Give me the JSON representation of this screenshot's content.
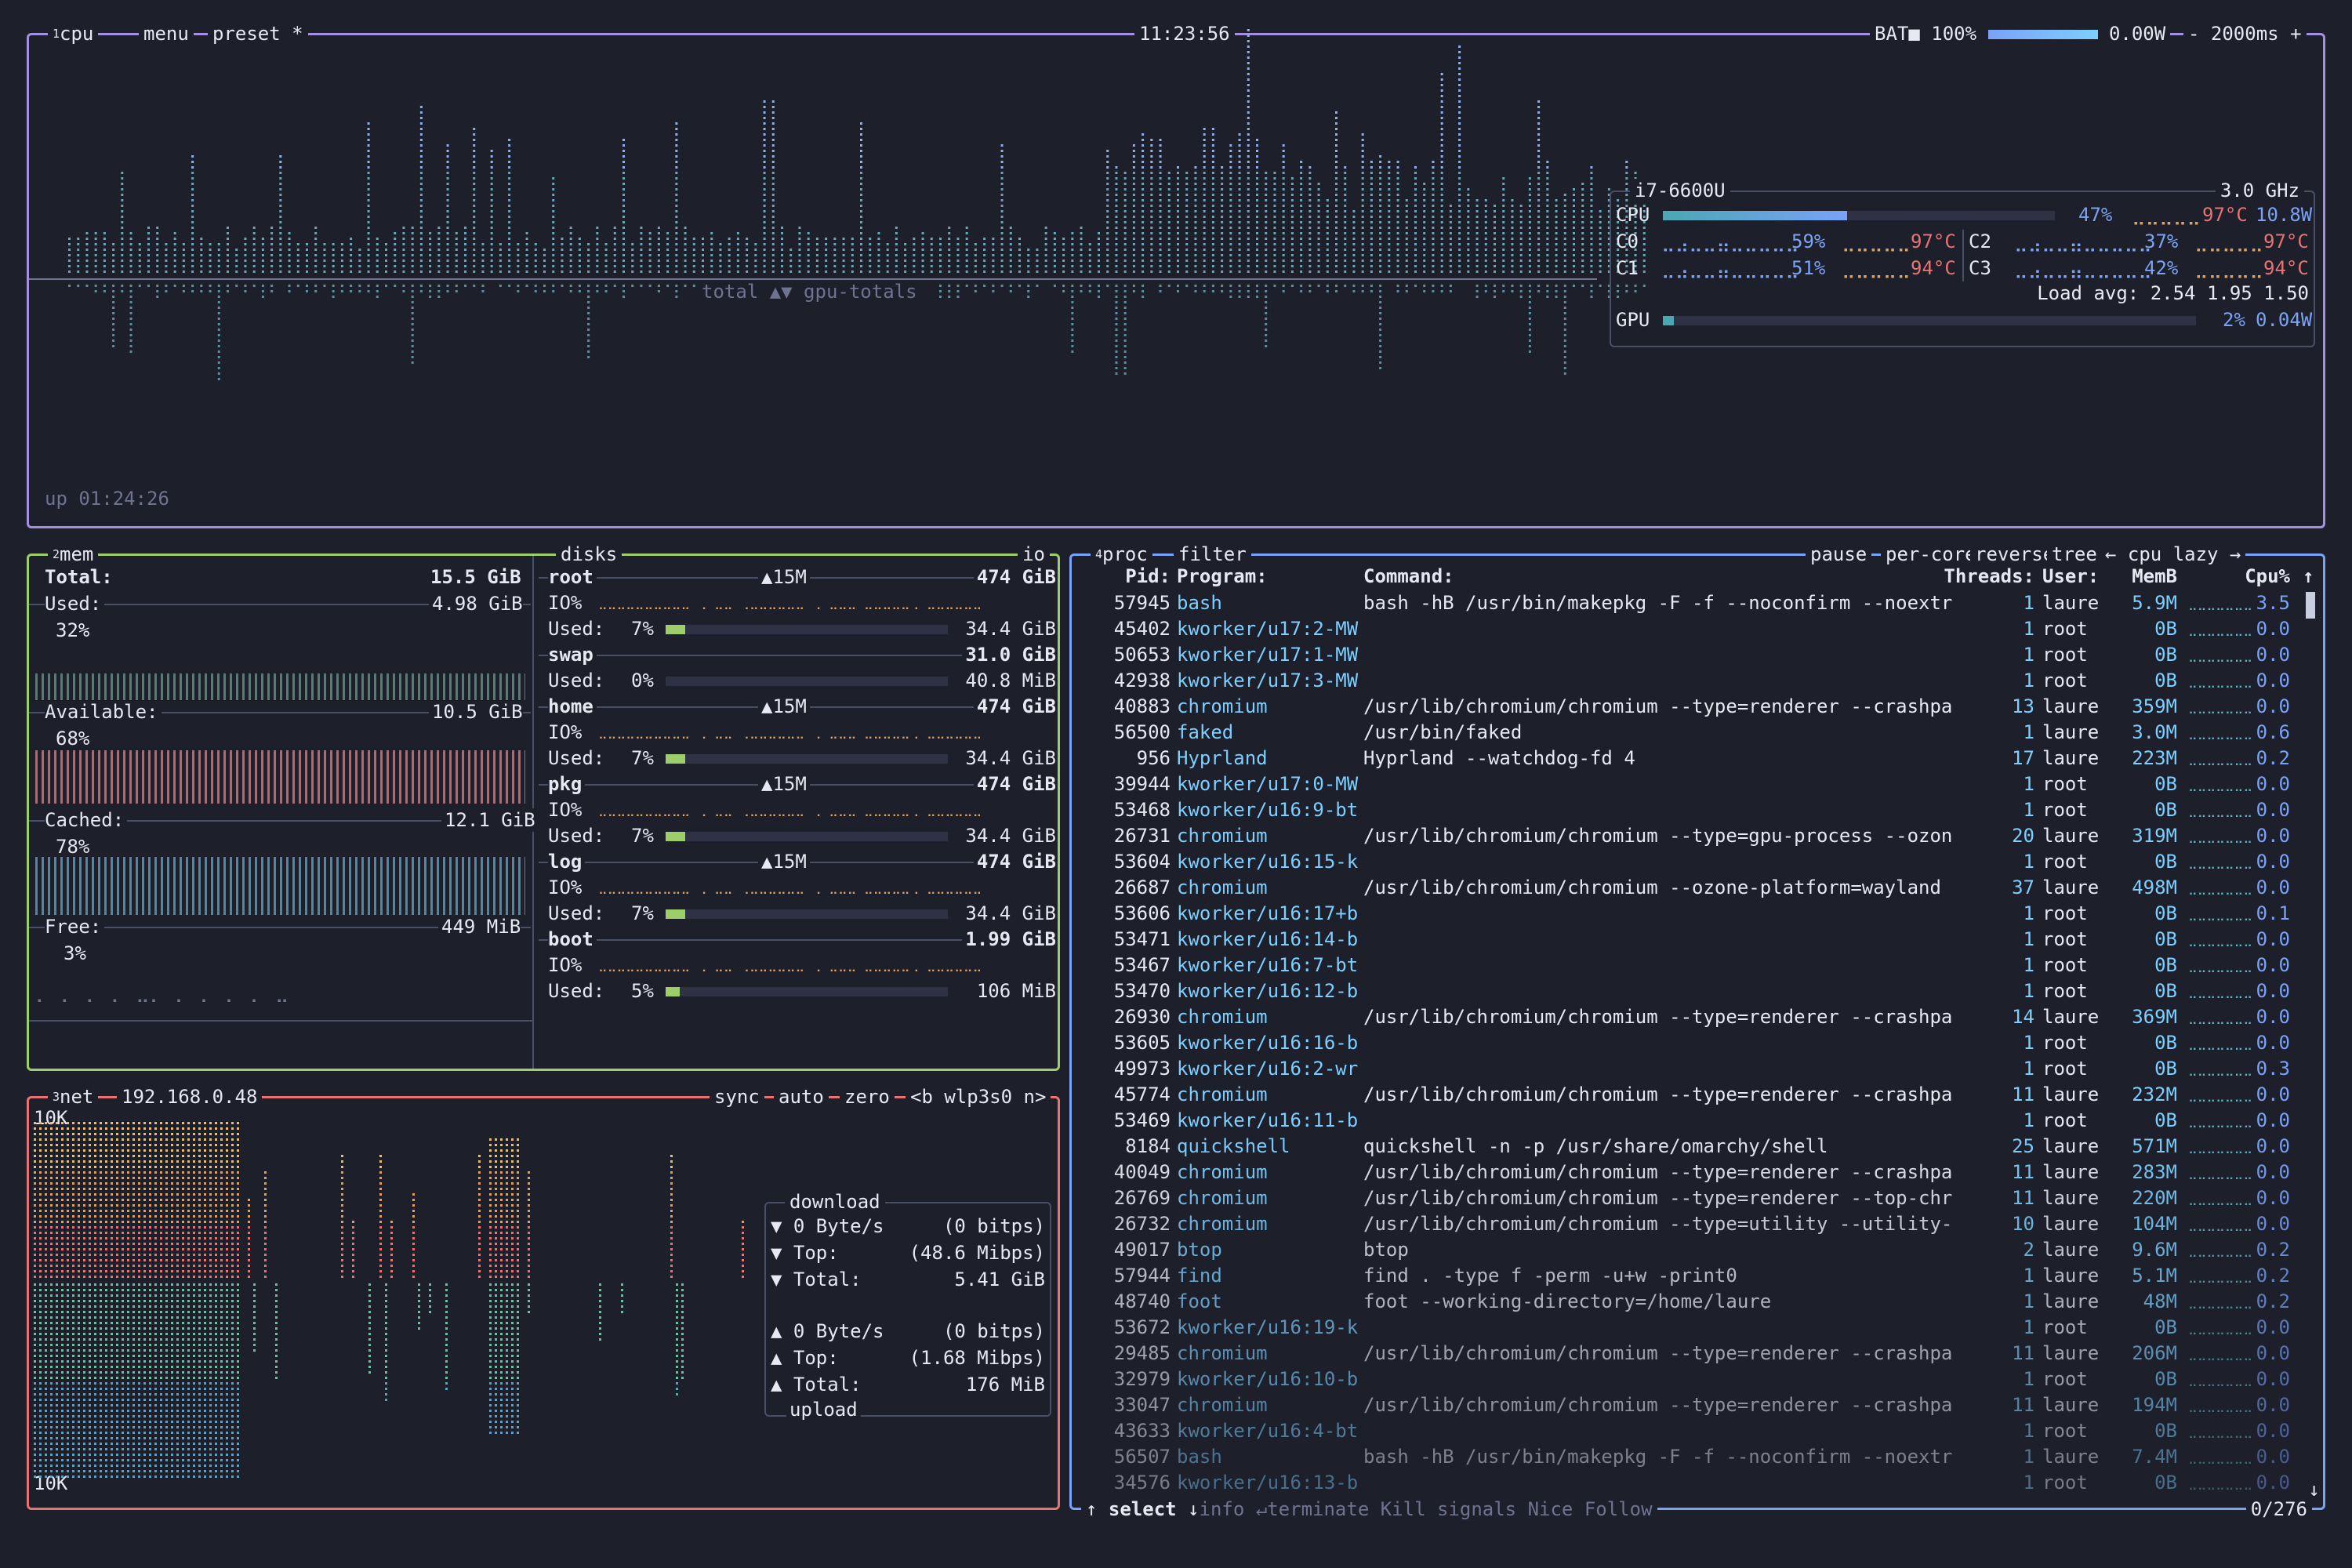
{
  "colors": {
    "cpu_border": "#a58fe0",
    "mem_border": "#9ece6a",
    "net_border": "#e87373",
    "proc_border": "#7aa2f7"
  },
  "cpu": {
    "num": "1",
    "title": "cpu",
    "menu": "menu",
    "preset": "preset *",
    "clock": "11:23:56",
    "battery_label": "BAT■",
    "battery_pct": "100%",
    "battery_fill": 1.0,
    "power": "0.00W",
    "minus": "-",
    "interval": "2000ms",
    "plus": "+",
    "graph_label": "total ▲▼ gpu-totals",
    "uptime": "up 01:24:26",
    "panel": {
      "model": "i7-6600U",
      "freq": "3.0 GHz",
      "cpu_label": "CPU",
      "cpu_fill": 0.47,
      "cpu_pct": "47%",
      "cpu_temp": "97°C",
      "cpu_watt": "10.8W",
      "cores": [
        {
          "name": "C0",
          "pct": "59%",
          "temp": "97°C"
        },
        {
          "name": "C1",
          "pct": "51%",
          "temp": "94°C"
        },
        {
          "name": "C2",
          "pct": "37%",
          "temp": "97°C"
        },
        {
          "name": "C3",
          "pct": "42%",
          "temp": "94°C"
        }
      ],
      "load_label": "Load avg:",
      "load": "2.54 1.95 1.50",
      "gpu_label": "GPU",
      "gpu_fill": 0.02,
      "gpu_pct": "2%",
      "gpu_watt": "0.04W"
    }
  },
  "mem": {
    "num": "2",
    "title": "mem",
    "total_label": "Total:",
    "total": "15.5 GiB",
    "used_label": "Used:",
    "used": "4.98 GiB",
    "used_pct": "32%",
    "avail_label": "Available:",
    "avail": "10.5 GiB",
    "avail_pct": "68%",
    "cached_label": "Cached:",
    "cached": "12.1 GiB",
    "cached_pct": "78%",
    "free_label": "Free:",
    "free": "449 MiB",
    "free_pct": "3%"
  },
  "disks": {
    "title": "disks",
    "io": "io",
    "items": [
      {
        "name": "root",
        "speed": "▲15M",
        "size": "474 GiB",
        "io": "IO%",
        "used_label": "Used:",
        "used_pct": "7%",
        "used_fill": 0.07,
        "used": "34.4 GiB"
      },
      {
        "name": "swap",
        "speed": "",
        "size": "31.0 GiB",
        "io": "",
        "used_label": "Used:",
        "used_pct": "0%",
        "used_fill": 0.0,
        "used": "40.8 MiB"
      },
      {
        "name": "home",
        "speed": "▲15M",
        "size": "474 GiB",
        "io": "IO%",
        "used_label": "Used:",
        "used_pct": "7%",
        "used_fill": 0.07,
        "used": "34.4 GiB"
      },
      {
        "name": "pkg",
        "speed": "▲15M",
        "size": "474 GiB",
        "io": "IO%",
        "used_label": "Used:",
        "used_pct": "7%",
        "used_fill": 0.07,
        "used": "34.4 GiB"
      },
      {
        "name": "log",
        "speed": "▲15M",
        "size": "474 GiB",
        "io": "IO%",
        "used_label": "Used:",
        "used_pct": "7%",
        "used_fill": 0.07,
        "used": "34.4 GiB"
      },
      {
        "name": "boot",
        "speed": "",
        "size": "1.99 GiB",
        "io": "IO%",
        "used_label": "Used:",
        "used_pct": "5%",
        "used_fill": 0.05,
        "used": "106 MiB"
      }
    ]
  },
  "net": {
    "num": "3",
    "title": "net",
    "ip": "192.168.0.48",
    "sync": "sync",
    "auto": "auto",
    "zero": "zero",
    "prev": "<b",
    "iface": "wlp3s0",
    "next": "n>",
    "scale_top": "10K",
    "scale_bottom": "10K",
    "download_label": "download",
    "upload_label": "upload",
    "dl_rate": "0 Byte/s",
    "dl_rate_bits": "(0 bitps)",
    "dl_top_label": "Top:",
    "dl_top": "(48.6 Mibps)",
    "dl_total_label": "Total:",
    "dl_total": "5.41 GiB",
    "ul_rate": "0 Byte/s",
    "ul_rate_bits": "(0 bitps)",
    "ul_top_label": "Top:",
    "ul_top": "(1.68 Mibps)",
    "ul_total_label": "Total:",
    "ul_total": "176 MiB"
  },
  "proc": {
    "num": "4",
    "title": "proc",
    "filter": "filter",
    "pause": "pause",
    "per_core": "per-core",
    "reverse": "reverse",
    "tree": "tree",
    "sort": "cpu lazy",
    "sort_prev": "←",
    "sort_next": "→",
    "headers": {
      "pid": "Pid:",
      "program": "Program:",
      "command": "Command:",
      "threads": "Threads:",
      "user": "User:",
      "mem": "MemB",
      "cpu": "Cpu%"
    },
    "rows": [
      {
        "pid": "57945",
        "program": "bash",
        "command": "bash -hB /usr/bin/makepkg -F -f --noconfirm --noextr",
        "threads": "1",
        "user": "laure",
        "mem": "5.9M",
        "cpu": "3.5"
      },
      {
        "pid": "45402",
        "program": "kworker/u17:2-MW",
        "command": "",
        "threads": "1",
        "user": "root",
        "mem": "0B",
        "cpu": "0.0"
      },
      {
        "pid": "50653",
        "program": "kworker/u17:1-MW",
        "command": "",
        "threads": "1",
        "user": "root",
        "mem": "0B",
        "cpu": "0.0"
      },
      {
        "pid": "42938",
        "program": "kworker/u17:3-MW",
        "command": "",
        "threads": "1",
        "user": "root",
        "mem": "0B",
        "cpu": "0.0"
      },
      {
        "pid": "40883",
        "program": "chromium",
        "command": "/usr/lib/chromium/chromium --type=renderer --crashpa",
        "threads": "13",
        "user": "laure",
        "mem": "359M",
        "cpu": "0.0"
      },
      {
        "pid": "56500",
        "program": "faked",
        "command": "/usr/bin/faked",
        "threads": "1",
        "user": "laure",
        "mem": "3.0M",
        "cpu": "0.6"
      },
      {
        "pid": "956",
        "program": "Hyprland",
        "command": "Hyprland --watchdog-fd 4",
        "threads": "17",
        "user": "laure",
        "mem": "223M",
        "cpu": "0.2"
      },
      {
        "pid": "39944",
        "program": "kworker/u17:0-MW",
        "command": "",
        "threads": "1",
        "user": "root",
        "mem": "0B",
        "cpu": "0.0"
      },
      {
        "pid": "53468",
        "program": "kworker/u16:9-bt",
        "command": "",
        "threads": "1",
        "user": "root",
        "mem": "0B",
        "cpu": "0.0"
      },
      {
        "pid": "26731",
        "program": "chromium",
        "command": "/usr/lib/chromium/chromium --type=gpu-process --ozon",
        "threads": "20",
        "user": "laure",
        "mem": "319M",
        "cpu": "0.0"
      },
      {
        "pid": "53604",
        "program": "kworker/u16:15-k",
        "command": "",
        "threads": "1",
        "user": "root",
        "mem": "0B",
        "cpu": "0.0"
      },
      {
        "pid": "26687",
        "program": "chromium",
        "command": "/usr/lib/chromium/chromium --ozone-platform=wayland",
        "threads": "37",
        "user": "laure",
        "mem": "498M",
        "cpu": "0.0"
      },
      {
        "pid": "53606",
        "program": "kworker/u16:17+b",
        "command": "",
        "threads": "1",
        "user": "root",
        "mem": "0B",
        "cpu": "0.1"
      },
      {
        "pid": "53471",
        "program": "kworker/u16:14-b",
        "command": "",
        "threads": "1",
        "user": "root",
        "mem": "0B",
        "cpu": "0.0"
      },
      {
        "pid": "53467",
        "program": "kworker/u16:7-bt",
        "command": "",
        "threads": "1",
        "user": "root",
        "mem": "0B",
        "cpu": "0.0"
      },
      {
        "pid": "53470",
        "program": "kworker/u16:12-b",
        "command": "",
        "threads": "1",
        "user": "root",
        "mem": "0B",
        "cpu": "0.0"
      },
      {
        "pid": "26930",
        "program": "chromium",
        "command": "/usr/lib/chromium/chromium --type=renderer --crashpa",
        "threads": "14",
        "user": "laure",
        "mem": "369M",
        "cpu": "0.0"
      },
      {
        "pid": "53605",
        "program": "kworker/u16:16-b",
        "command": "",
        "threads": "1",
        "user": "root",
        "mem": "0B",
        "cpu": "0.0"
      },
      {
        "pid": "49973",
        "program": "kworker/u16:2-wr",
        "command": "",
        "threads": "1",
        "user": "root",
        "mem": "0B",
        "cpu": "0.3"
      },
      {
        "pid": "45774",
        "program": "chromium",
        "command": "/usr/lib/chromium/chromium --type=renderer --crashpa",
        "threads": "11",
        "user": "laure",
        "mem": "232M",
        "cpu": "0.0"
      },
      {
        "pid": "53469",
        "program": "kworker/u16:11-b",
        "command": "",
        "threads": "1",
        "user": "root",
        "mem": "0B",
        "cpu": "0.0"
      },
      {
        "pid": "8184",
        "program": "quickshell",
        "command": "quickshell -n -p /usr/share/omarchy/shell",
        "threads": "25",
        "user": "laure",
        "mem": "571M",
        "cpu": "0.0"
      },
      {
        "pid": "40049",
        "program": "chromium",
        "command": "/usr/lib/chromium/chromium --type=renderer --crashpa",
        "threads": "11",
        "user": "laure",
        "mem": "283M",
        "cpu": "0.0"
      },
      {
        "pid": "26769",
        "program": "chromium",
        "command": "/usr/lib/chromium/chromium --type=renderer --top-chr",
        "threads": "11",
        "user": "laure",
        "mem": "220M",
        "cpu": "0.0"
      },
      {
        "pid": "26732",
        "program": "chromium",
        "command": "/usr/lib/chromium/chromium --type=utility --utility-",
        "threads": "10",
        "user": "laure",
        "mem": "104M",
        "cpu": "0.0"
      },
      {
        "pid": "49017",
        "program": "btop",
        "command": "btop",
        "threads": "2",
        "user": "laure",
        "mem": "9.6M",
        "cpu": "0.2"
      },
      {
        "pid": "57944",
        "program": "find",
        "command": "find . -type f -perm -u+w -print0",
        "threads": "1",
        "user": "laure",
        "mem": "5.1M",
        "cpu": "0.2"
      },
      {
        "pid": "48740",
        "program": "foot",
        "command": "foot --working-directory=/home/laure",
        "threads": "1",
        "user": "laure",
        "mem": "48M",
        "cpu": "0.2"
      },
      {
        "pid": "53672",
        "program": "kworker/u16:19-k",
        "command": "",
        "threads": "1",
        "user": "root",
        "mem": "0B",
        "cpu": "0.0"
      },
      {
        "pid": "29485",
        "program": "chromium",
        "command": "/usr/lib/chromium/chromium --type=renderer --crashpa",
        "threads": "11",
        "user": "laure",
        "mem": "206M",
        "cpu": "0.0"
      },
      {
        "pid": "32979",
        "program": "kworker/u16:10-b",
        "command": "",
        "threads": "1",
        "user": "root",
        "mem": "0B",
        "cpu": "0.0"
      },
      {
        "pid": "33047",
        "program": "chromium",
        "command": "/usr/lib/chromium/chromium --type=renderer --crashpa",
        "threads": "11",
        "user": "laure",
        "mem": "194M",
        "cpu": "0.0"
      },
      {
        "pid": "43633",
        "program": "kworker/u16:4-bt",
        "command": "",
        "threads": "1",
        "user": "root",
        "mem": "0B",
        "cpu": "0.0"
      },
      {
        "pid": "56507",
        "program": "bash",
        "command": "bash -hB /usr/bin/makepkg -F -f --noconfirm --noextr",
        "threads": "1",
        "user": "laure",
        "mem": "7.4M",
        "cpu": "0.0"
      },
      {
        "pid": "34576",
        "program": "kworker/u16:13-b",
        "command": "",
        "threads": "1",
        "user": "root",
        "mem": "0B",
        "cpu": "0.0"
      }
    ],
    "footer": {
      "up": "↑",
      "select": "select",
      "down": "↓",
      "info": "info",
      "enter": "↵",
      "terminate": "terminate",
      "kill": "Kill",
      "signals": "signals",
      "nice": "Nice",
      "follow": "Follow",
      "count": "0/276",
      "scroll_up": "↑",
      "scroll_down": "↓"
    }
  }
}
